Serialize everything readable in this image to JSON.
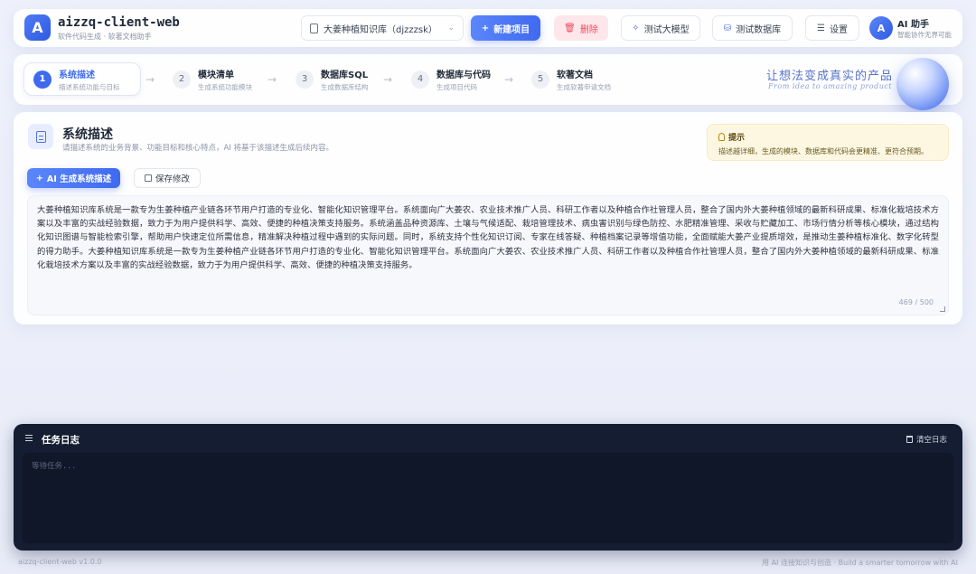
{
  "header": {
    "logo_letter": "A",
    "app_name": "aizzq-client-web",
    "app_subtitle": "软件代码生成 · 软著文档助手",
    "knowledge_base": "大姜种植知识库（djzzzsk）",
    "new_project": "新建项目",
    "delete": "删除",
    "test_llm": "测试大模型",
    "test_db": "测试数据库",
    "settings": "设置",
    "assistant_avatar": "A",
    "assistant_name": "AI 助手",
    "assistant_desc": "智能协作无界可能"
  },
  "steps": [
    {
      "num": "1",
      "title": "系统描述",
      "desc": "描述系统功能与目标"
    },
    {
      "num": "2",
      "title": "模块清单",
      "desc": "生成系统功能模块"
    },
    {
      "num": "3",
      "title": "数据库SQL",
      "desc": "生成数据库结构"
    },
    {
      "num": "4",
      "title": "数据库与代码",
      "desc": "生成项目代码"
    },
    {
      "num": "5",
      "title": "软著文档",
      "desc": "生成软著申请文档"
    }
  ],
  "slogan": {
    "cn": "让想法变成真实的产品",
    "en": "From idea to amazing product"
  },
  "section": {
    "title": "系统描述",
    "subtitle": "请描述系统的业务背景、功能目标和核心特点，AI 将基于该描述生成后续内容。",
    "tip_title": "提示",
    "tip_text": "描述越详细，生成的模块、数据库和代码会更精准、更符合预期。",
    "generate_button": "AI 生成系统描述",
    "save_button": "保存修改",
    "description": "大姜种植知识库系统是一款专为生姜种植产业链各环节用户打造的专业化、智能化知识管理平台。系统面向广大姜农、农业技术推广人员、科研工作者以及种植合作社管理人员，整合了国内外大姜种植领域的最新科研成果、标准化栽培技术方案以及丰富的实战经验数据，致力于为用户提供科学、高效、便捷的种植决策支持服务。系统涵盖品种资源库、土壤与气候适配、栽培管理技术、病虫害识别与绿色防控、水肥精准管理、采收与贮藏加工、市场行情分析等核心模块，通过结构化知识图谱与智能检索引擎，帮助用户快速定位所需信息，精准解决种植过程中遇到的实际问题。同时，系统支持个性化知识订阅、专家在线答疑、种植档案记录等增值功能，全面赋能大姜产业提质增效，是推动生姜种植标准化、数字化转型的得力助手。大姜种植知识库系统是一款专为生姜种植产业链各环节用户打造的专业化、智能化知识管理平台。系统面向广大姜农、农业技术推广人员、科研工作者以及种植合作社管理人员，整合了国内外大姜种植领域的最新科研成果、标准化栽培技术方案以及丰富的实战经验数据，致力于为用户提供科学、高效、便捷的种植决策支持服务。",
    "counter": "469 / 500"
  },
  "log": {
    "title": "任务日志",
    "clear": "清空日志",
    "placeholder": "等待任务..."
  },
  "footer": {
    "version": "aizzq-client-web v1.0.0",
    "tagline": "用 AI 连接知识与创造 · Build a smarter tomorrow with AI"
  }
}
